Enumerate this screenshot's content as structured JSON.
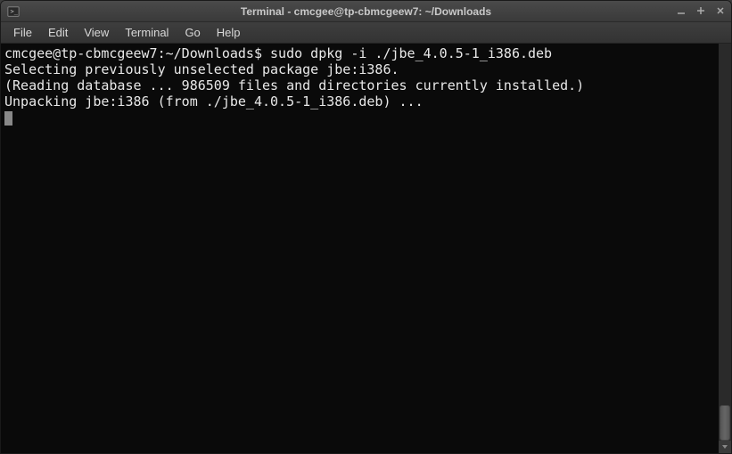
{
  "window": {
    "title": "Terminal - cmcgee@tp-cbmcgeew7: ~/Downloads"
  },
  "menubar": {
    "items": [
      {
        "label": "File"
      },
      {
        "label": "Edit"
      },
      {
        "label": "View"
      },
      {
        "label": "Terminal"
      },
      {
        "label": "Go"
      },
      {
        "label": "Help"
      }
    ]
  },
  "terminal": {
    "prompt": "cmcgee@tp-cbmcgeew7:~/Downloads$ ",
    "command": "sudo dpkg -i ./jbe_4.0.5-1_i386.deb",
    "lines": [
      "Selecting previously unselected package jbe:i386.",
      "(Reading database ... 986509 files and directories currently installed.)",
      "Unpacking jbe:i386 (from ./jbe_4.0.5-1_i386.deb) ..."
    ]
  }
}
